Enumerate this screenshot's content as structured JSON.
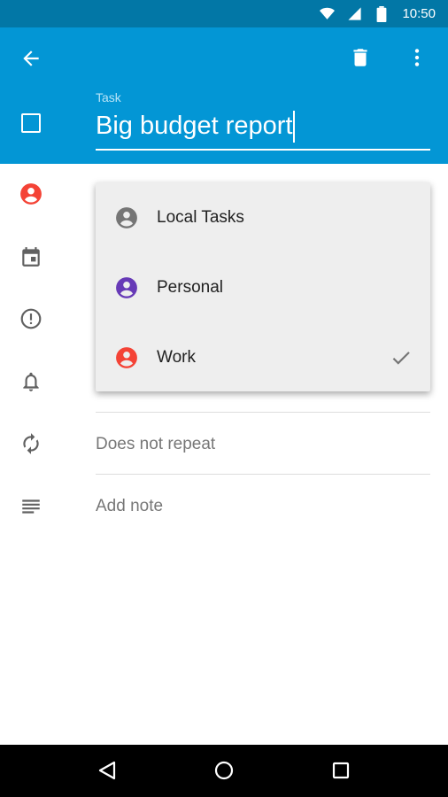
{
  "status_bar": {
    "time": "10:50",
    "icons": [
      "wifi-icon",
      "signal-icon",
      "battery-icon"
    ]
  },
  "app_bar": {
    "back_icon": "back-arrow-icon",
    "delete_icon": "trash-icon",
    "overflow_icon": "more-vert-icon"
  },
  "task": {
    "field_label": "Task",
    "title": "Big budget report",
    "completed": false
  },
  "list_picker": {
    "options": [
      {
        "label": "Local Tasks",
        "color": "#757575",
        "selected": false
      },
      {
        "label": "Personal",
        "color": "#673ab7",
        "selected": false
      },
      {
        "label": "Work",
        "color": "#f44336",
        "selected": true
      }
    ]
  },
  "fields": {
    "repeat": "Does not repeat",
    "note_placeholder": "Add note"
  },
  "colors": {
    "status_bar": "#0277a6",
    "app_bar": "#0396d5",
    "work_accent": "#f44336"
  },
  "nav_bar": {
    "icons": [
      "back-triangle-icon",
      "home-circle-icon",
      "recents-square-icon"
    ]
  }
}
